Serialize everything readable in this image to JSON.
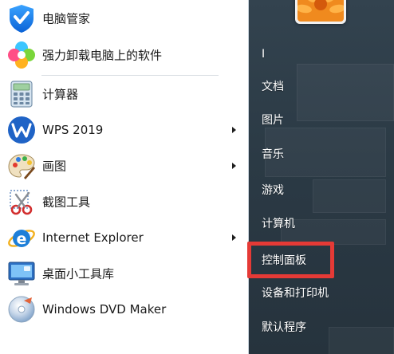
{
  "start_menu": {
    "programs": [
      {
        "label": "电脑管家",
        "icon": "tencent-pc-manager-shield-icon",
        "has_submenu": false
      },
      {
        "label": "强力卸载电脑上的软件",
        "icon": "uninstall-clover-icon",
        "has_submenu": false
      },
      {
        "label": "计算器",
        "icon": "calculator-icon",
        "has_submenu": false
      },
      {
        "label": "WPS 2019",
        "icon": "wps-office-icon",
        "has_submenu": true
      },
      {
        "label": "画图",
        "icon": "paint-palette-icon",
        "has_submenu": true
      },
      {
        "label": "截图工具",
        "icon": "snipping-tool-scissors-icon",
        "has_submenu": false
      },
      {
        "label": "Internet Explorer",
        "icon": "internet-explorer-icon",
        "has_submenu": true
      },
      {
        "label": "桌面小工具库",
        "icon": "desktop-gadgets-icon",
        "has_submenu": false
      },
      {
        "label": "Windows DVD Maker",
        "icon": "dvd-maker-icon",
        "has_submenu": false
      }
    ],
    "places": [
      {
        "label": "I"
      },
      {
        "label": "文档"
      },
      {
        "label": "图片"
      },
      {
        "label": "音乐"
      },
      {
        "label": "游戏"
      },
      {
        "label": "计算机"
      },
      {
        "label": "控制面板",
        "highlighted": true
      },
      {
        "label": "设备和打印机"
      },
      {
        "label": "默认程序"
      }
    ],
    "colors": {
      "highlight_border": "#e53a36",
      "right_pane_bg": "#2b3a45",
      "left_pane_bg": "#ffffff"
    }
  }
}
